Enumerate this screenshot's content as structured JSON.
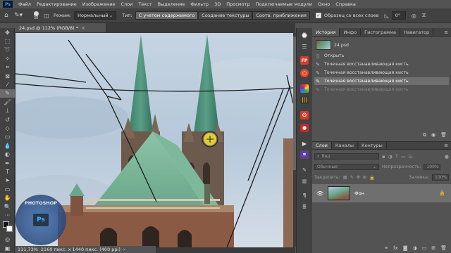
{
  "menu": [
    "Файл",
    "Редактирование",
    "Изображение",
    "Слои",
    "Текст",
    "Выделение",
    "Фильтр",
    "3D",
    "Просмотр",
    "Подключаемые модули",
    "Окно",
    "Справка"
  ],
  "app_logo": "Ps",
  "options": {
    "brush_size": "30",
    "mode_label": "Режим:",
    "mode_value": "Нормальный",
    "type_label": "Тип:",
    "type_content_aware": "С учетом содержимого",
    "type_texture": "Создание текстуры",
    "type_proximity": "Соотв. приближения",
    "sample_all_layers": "Образец со всех слоев",
    "angle_value": "0°"
  },
  "document": {
    "tab_title": "24.psd @ 112% (RGB/8) *",
    "status": "111,73%",
    "status_dims": "2160 пикс. x 1440 пикс. (400 ppi)"
  },
  "history": {
    "tabs": [
      "История",
      "Инфо",
      "Гистограмма",
      "Навигатор"
    ],
    "snapshot": "24.psd",
    "items": [
      {
        "label": "Открыть",
        "icon": "document-icon"
      },
      {
        "label": "Точечная восстанавливающая кисть",
        "icon": "healing-brush-icon"
      },
      {
        "label": "Точечная восстанавливающая кисть",
        "icon": "healing-brush-icon"
      },
      {
        "label": "Точечная восстанавливающая кисть",
        "icon": "healing-brush-icon",
        "selected": true
      },
      {
        "label": "Точечная восстанавливающая кисть",
        "icon": "healing-brush-icon",
        "dimmed": true
      }
    ]
  },
  "layers": {
    "tabs": [
      "Слои",
      "Каналы",
      "Контуры"
    ],
    "filter_placeholder": "Вид",
    "blend_mode": "Обычные",
    "opacity_label": "Непрозрачность:",
    "opacity_value": "100%",
    "lock_label": "Закрепить:",
    "fill_label": "Заливка:",
    "fill_value": "100%",
    "layer_name": "Фон"
  },
  "watermark_text": "PHOTOSHOP",
  "colors": {
    "accent_blue": "#31a8ff",
    "panel_bg": "#535353",
    "dark_bg": "#424242",
    "selection": "#6f6f6f"
  }
}
